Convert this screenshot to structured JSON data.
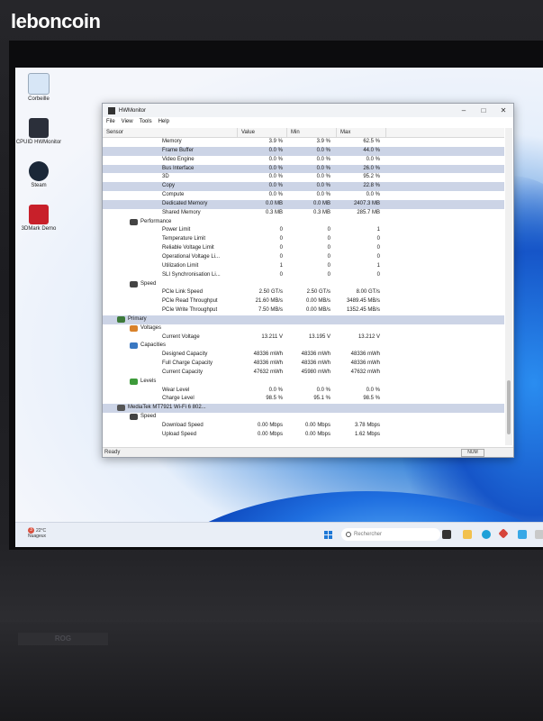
{
  "site_logo": "leboncoin",
  "desktop_icons": [
    {
      "label": "Corbeille",
      "icon": "recycle-bin-icon"
    },
    {
      "label": "CPUID HWMonitor",
      "icon": "hwmonitor-icon"
    },
    {
      "label": "Steam",
      "icon": "steam-icon"
    },
    {
      "label": "3DMark Demo",
      "icon": "3dmark-icon"
    }
  ],
  "window": {
    "title": "HWMonitor",
    "menu": [
      "File",
      "View",
      "Tools",
      "Help"
    ],
    "columns": [
      "Sensor",
      "Value",
      "Min",
      "Max"
    ],
    "status_left": "Ready",
    "status_num": "NUM"
  },
  "rows": [
    {
      "name": "Memory",
      "value": "3.9 %",
      "min": "3.9 %",
      "max": "62.5 %",
      "level": 3,
      "sel": false
    },
    {
      "name": "Frame Buffer",
      "value": "0.0 %",
      "min": "0.0 %",
      "max": "44.0 %",
      "level": 3,
      "sel": true
    },
    {
      "name": "Video Engine",
      "value": "0.0 %",
      "min": "0.0 %",
      "max": "0.0 %",
      "level": 3,
      "sel": false
    },
    {
      "name": "Bus Interface",
      "value": "0.0 %",
      "min": "0.0 %",
      "max": "26.0 %",
      "level": 3,
      "sel": true
    },
    {
      "name": "3D",
      "value": "0.0 %",
      "min": "0.0 %",
      "max": "95.2 %",
      "level": 3,
      "sel": false
    },
    {
      "name": "Copy",
      "value": "0.0 %",
      "min": "0.0 %",
      "max": "22.8 %",
      "level": 3,
      "sel": true
    },
    {
      "name": "Compute",
      "value": "0.0 %",
      "min": "0.0 %",
      "max": "0.0 %",
      "level": 3,
      "sel": false
    },
    {
      "name": "Dedicated Memory",
      "value": "0.0 MB",
      "min": "0.0 MB",
      "max": "2407.3 MB",
      "level": 3,
      "sel": true
    },
    {
      "name": "Shared Memory",
      "value": "0.3 MB",
      "min": "0.3 MB",
      "max": "285.7 MB",
      "level": 3,
      "sel": false
    },
    {
      "name": "Performance",
      "value": "",
      "min": "",
      "max": "",
      "level": 2,
      "group": true,
      "icon": "gauge-icon"
    },
    {
      "name": "Power Limit",
      "value": "0",
      "min": "0",
      "max": "1",
      "level": 3
    },
    {
      "name": "Temperature Limit",
      "value": "0",
      "min": "0",
      "max": "0",
      "level": 3
    },
    {
      "name": "Reliable Voltage Limit",
      "value": "0",
      "min": "0",
      "max": "0",
      "level": 3
    },
    {
      "name": "Operational Voltage Li...",
      "value": "0",
      "min": "0",
      "max": "0",
      "level": 3
    },
    {
      "name": "Utilization Limit",
      "value": "1",
      "min": "0",
      "max": "1",
      "level": 3
    },
    {
      "name": "SLI Synchronisation Li...",
      "value": "0",
      "min": "0",
      "max": "0",
      "level": 3
    },
    {
      "name": "Speed",
      "value": "",
      "min": "",
      "max": "",
      "level": 2,
      "group": true,
      "icon": "gauge-icon"
    },
    {
      "name": "PCIe Link Speed",
      "value": "2.50 GT/s",
      "min": "2.50 GT/s",
      "max": "8.00 GT/s",
      "level": 3
    },
    {
      "name": "PCIe Read Throughput",
      "value": "21.60 MB/s",
      "min": "0.00 MB/s",
      "max": "3489.45 MB/s",
      "level": 3
    },
    {
      "name": "PCIe Write Throughput",
      "value": "7.50 MB/s",
      "min": "0.00 MB/s",
      "max": "1352.45 MB/s",
      "level": 3
    },
    {
      "name": "Primary",
      "value": "",
      "min": "",
      "max": "",
      "level": 1,
      "group": true,
      "icon": "battery-icon",
      "sel": true
    },
    {
      "name": "Voltages",
      "value": "",
      "min": "",
      "max": "",
      "level": 2,
      "group": true,
      "icon": "voltage-chart-icon"
    },
    {
      "name": "Current Voltage",
      "value": "13.211 V",
      "min": "13.195 V",
      "max": "13.212 V",
      "level": 3
    },
    {
      "name": "Capacities",
      "value": "",
      "min": "",
      "max": "",
      "level": 2,
      "group": true,
      "icon": "capacity-chart-icon"
    },
    {
      "name": "Designed Capacity",
      "value": "48336 mWh",
      "min": "48336 mWh",
      "max": "48336 mWh",
      "level": 3
    },
    {
      "name": "Full Charge Capacity",
      "value": "48336 mWh",
      "min": "48336 mWh",
      "max": "48336 mWh",
      "level": 3
    },
    {
      "name": "Current Capacity",
      "value": "47632 mWh",
      "min": "45980 mWh",
      "max": "47632 mWh",
      "level": 3
    },
    {
      "name": "Levels",
      "value": "",
      "min": "",
      "max": "",
      "level": 2,
      "group": true,
      "icon": "levels-icon"
    },
    {
      "name": "Wear Level",
      "value": "0.0 %",
      "min": "0.0 %",
      "max": "0.0 %",
      "level": 3
    },
    {
      "name": "Charge Level",
      "value": "98.5 %",
      "min": "95.1 %",
      "max": "98.5 %",
      "level": 3
    },
    {
      "name": "MediaTek MT7921 Wi-Fi 6 802...",
      "value": "",
      "min": "",
      "max": "",
      "level": 1,
      "group": true,
      "icon": "network-icon",
      "sel": true
    },
    {
      "name": "Speed",
      "value": "",
      "min": "",
      "max": "",
      "level": 2,
      "group": true,
      "icon": "gauge-icon"
    },
    {
      "name": "Download Speed",
      "value": "0.00 Mbps",
      "min": "0.00 Mbps",
      "max": "3.78 Mbps",
      "level": 3
    },
    {
      "name": "Upload Speed",
      "value": "0.00 Mbps",
      "min": "0.00 Mbps",
      "max": "1.62 Mbps",
      "level": 3
    }
  ],
  "taskbar": {
    "weather_temp": "22°C",
    "weather_desc": "Nuageux",
    "search_placeholder": "Rechercher"
  },
  "keyboard_trim": "ROG"
}
